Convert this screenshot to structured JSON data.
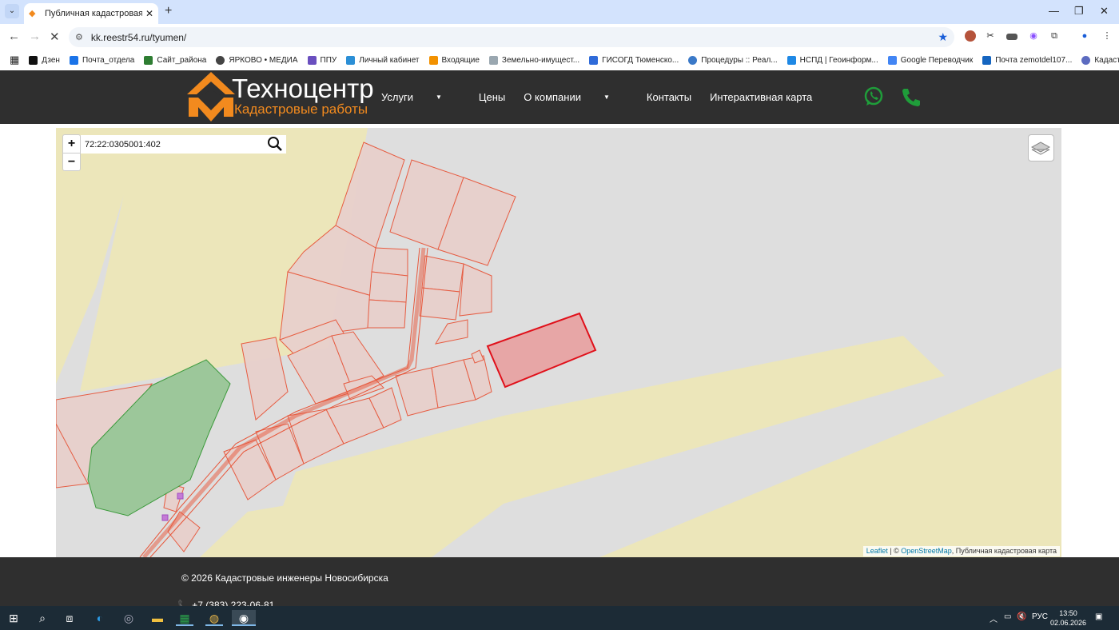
{
  "browser": {
    "tab_title": "Публичная кадастровая карта",
    "url": "kk.reestr54.ru/tyumen/",
    "new_tab": "+",
    "tab_close": "✕"
  },
  "bookmarks": [
    {
      "label": "Дзен",
      "color": "#111111"
    },
    {
      "label": "Почта_отдела",
      "color": "#1a73e8"
    },
    {
      "label": "Сайт_района",
      "color": "#2e7d32"
    },
    {
      "label": "ЯРКОВО • МЕДИА",
      "color": "#444444"
    },
    {
      "label": "ППУ",
      "color": "#6a4fbf"
    },
    {
      "label": "Личный кабинет",
      "color": "#2b8fd6"
    },
    {
      "label": "Входящие",
      "color": "#f29100"
    },
    {
      "label": "Земельно-имущест...",
      "color": "#9aa7b0"
    },
    {
      "label": "ГИСОГД Тюменско...",
      "color": "#2f6bd9"
    },
    {
      "label": "Процедуры :: Реал...",
      "color": "#3a79c8"
    },
    {
      "label": "НСПД | Геоинформ...",
      "color": "#1e88e5"
    },
    {
      "label": "Google Переводчик",
      "color": "#4285f4"
    },
    {
      "label": "Почта zemotdel107...",
      "color": "#1565c0"
    },
    {
      "label": "Кадастровая карта:...",
      "color": "#5c6bc0"
    }
  ],
  "site": {
    "brand": "Техноцентр",
    "brand_sub": "Кадастровые работы",
    "brand_color": "#f28a1e",
    "menu": {
      "services": "Услуги",
      "prices": "Цены",
      "about": "О компании",
      "contacts": "Контакты",
      "map": "Интерактивная карта"
    },
    "contact_color": "#1f9d3a"
  },
  "map": {
    "zoom_in": "+",
    "zoom_out": "−",
    "search_value": "72:22:0305001:402",
    "attribution": {
      "leaflet": "Leaflet",
      "sep": " | © ",
      "osm": "OpenStreetMap",
      "rest": ", Публичная кадастровая карта"
    }
  },
  "footer": {
    "copyright": "© 2026 Кадастровые инженеры Новосибирска",
    "phone": "+7 (383) 223-06-81"
  },
  "taskbar": {
    "lang": "РУС",
    "time": "13:50",
    "date": "02.06.2026"
  }
}
